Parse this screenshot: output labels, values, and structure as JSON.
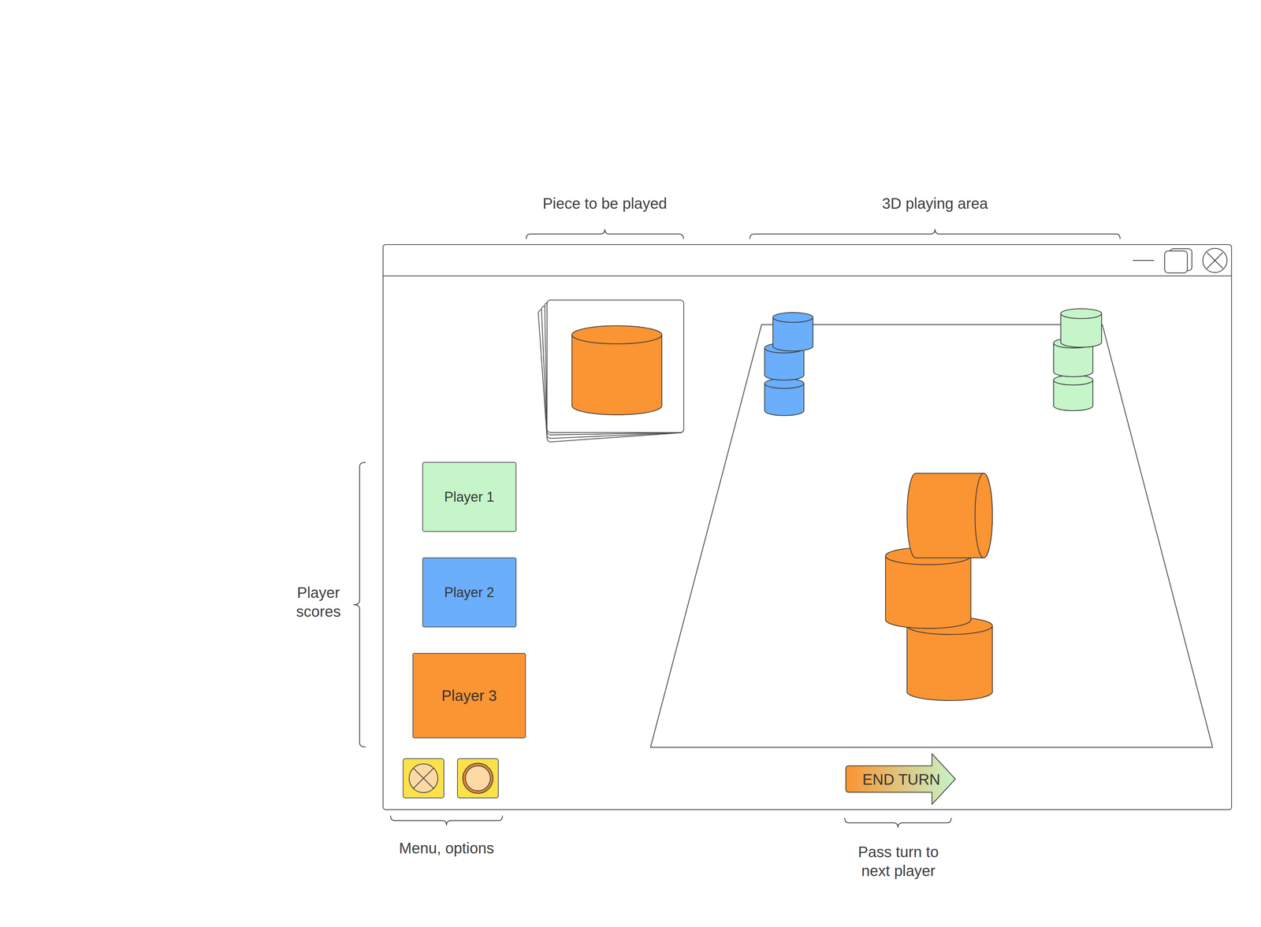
{
  "annotations": {
    "piece": "Piece to be played",
    "area": "3D playing area",
    "scores": "Player scores",
    "menu": "Menu, options",
    "pass": "Pass turn to next player"
  },
  "piece_to_play": {
    "color": "#fb9432"
  },
  "players": [
    {
      "name": "Player 1",
      "color": "#c5f5c9",
      "selected": false
    },
    {
      "name": "Player 2",
      "color": "#6aaefc",
      "selected": false
    },
    {
      "name": "Player 3",
      "color": "#fb9432",
      "selected": true
    }
  ],
  "board": {
    "stacks": [
      {
        "color": "#6aaefc",
        "pieces": [
          {
            "kind": "upright"
          },
          {
            "kind": "upright"
          },
          {
            "kind": "upright"
          }
        ]
      },
      {
        "color": "#c5f5c9",
        "pieces": [
          {
            "kind": "upright"
          },
          {
            "kind": "upright"
          },
          {
            "kind": "upright"
          }
        ]
      },
      {
        "color": "#fb9432",
        "pieces": [
          {
            "kind": "upright"
          },
          {
            "kind": "upright"
          },
          {
            "kind": "side"
          }
        ]
      }
    ]
  },
  "end_turn": {
    "label": "END TURN"
  }
}
